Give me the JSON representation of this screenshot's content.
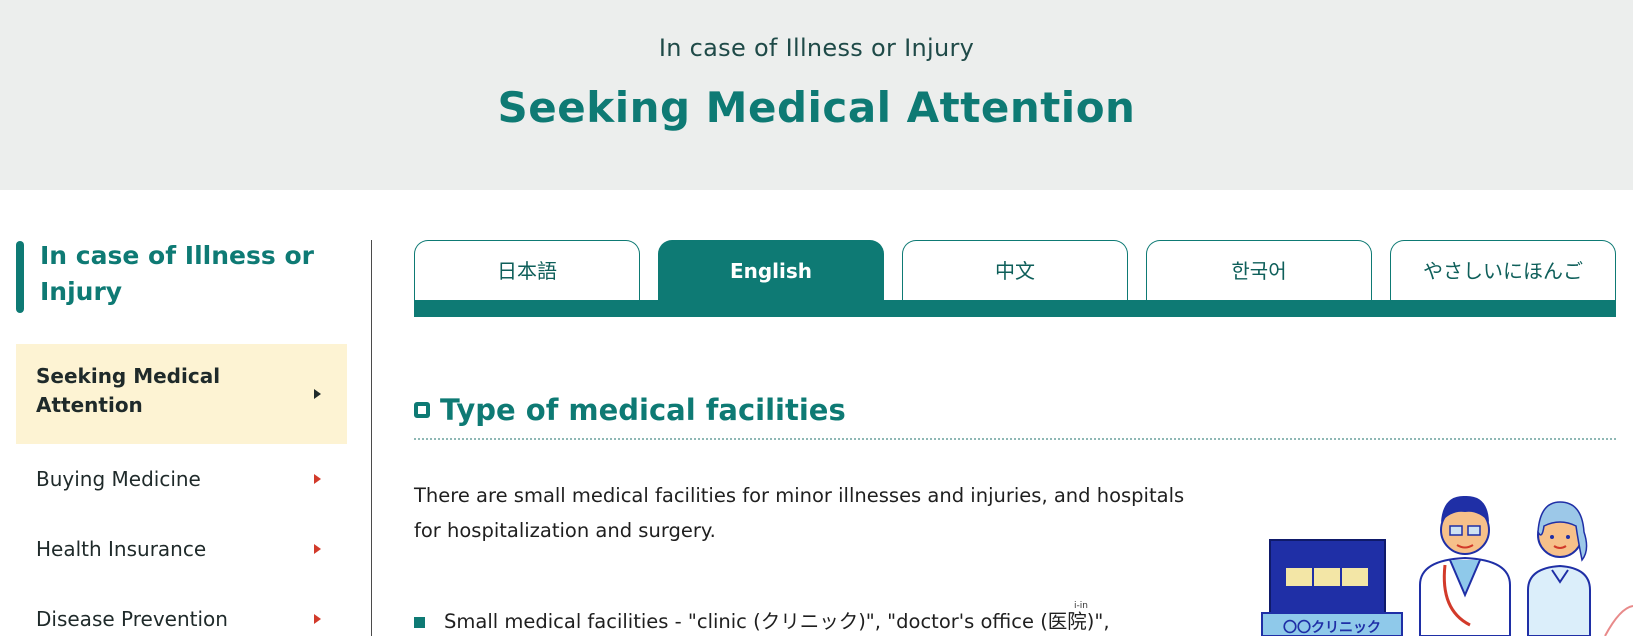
{
  "header": {
    "subtitle": "In case of Illness or Injury",
    "title": "Seeking Medical Attention"
  },
  "sidebar": {
    "heading_line1": "In case of Illness or",
    "heading_line2": "Injury",
    "items": [
      {
        "label_line1": "Seeking Medical",
        "label_line2": "Attention",
        "active": true
      },
      {
        "label": "Buying Medicine"
      },
      {
        "label": "Health Insurance"
      },
      {
        "label": "Disease Prevention"
      }
    ]
  },
  "tabs": [
    {
      "label": "日本語"
    },
    {
      "label": "English",
      "active": true
    },
    {
      "label": "中文"
    },
    {
      "label": "한국어"
    },
    {
      "label": "やさしいにほんご"
    }
  ],
  "section": {
    "title": "Type of medical facilities",
    "paragraph_line1": "There are small medical facilities for minor illnesses and injuries, and hospitals",
    "paragraph_line2": "for hospitalization and surgery.",
    "bullet": "Small medical facilities - \"clinic (クリニック)\", \"doctor's office (医院)\",",
    "ruby": "i-in"
  },
  "illustration": {
    "sign_text": "〇〇クリニック"
  },
  "colors": {
    "accent": "#0e7a74",
    "header_bg": "#eceeed",
    "active_item_bg": "#fdf3d3",
    "arrow": "#d23a2a"
  }
}
